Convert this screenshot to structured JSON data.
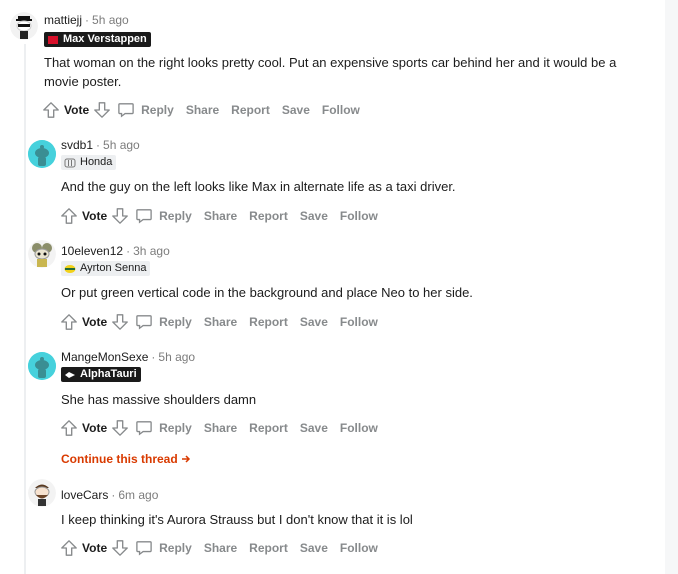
{
  "comments": [
    {
      "author": "mattiejj",
      "time": "5h ago",
      "flair": "Max Verstappen",
      "text": "That woman on the right looks pretty cool. Put an expensive sports car behind her and it would be a movie poster.",
      "actions": {
        "vote": "Vote",
        "reply": "Reply",
        "share": "Share",
        "report": "Report",
        "save": "Save",
        "follow": "Follow"
      }
    },
    {
      "author": "svdb1",
      "time": "5h ago",
      "flair": "Honda",
      "text": "And the guy on the left looks like Max in alternate life as a taxi driver.",
      "actions": {
        "vote": "Vote",
        "reply": "Reply",
        "share": "Share",
        "report": "Report",
        "save": "Save",
        "follow": "Follow"
      }
    },
    {
      "author": "10eleven12",
      "time": "3h ago",
      "flair": "Ayrton Senna",
      "text": "Or put green vertical code in the background and place Neo to her side.",
      "actions": {
        "vote": "Vote",
        "reply": "Reply",
        "share": "Share",
        "report": "Report",
        "save": "Save",
        "follow": "Follow"
      }
    },
    {
      "author": "MangeMonSexe",
      "time": "5h ago",
      "flair": "AlphaTauri",
      "text": "She has massive shoulders damn",
      "actions": {
        "vote": "Vote",
        "reply": "Reply",
        "share": "Share",
        "report": "Report",
        "save": "Save",
        "follow": "Follow"
      }
    },
    {
      "author": "loveCars",
      "time": "6m ago",
      "flair": "",
      "text": "I keep thinking it's Aurora Strauss but I don't know that it is lol",
      "actions": {
        "vote": "Vote",
        "reply": "Reply",
        "share": "Share",
        "report": "Report",
        "save": "Save",
        "follow": "Follow"
      }
    }
  ],
  "continue_thread": "Continue this thread",
  "colors": {
    "accent": "#d93a00",
    "flair_dark": "#1a1a1a",
    "flair_light": "#edeff1",
    "muted": "#878a8c"
  }
}
